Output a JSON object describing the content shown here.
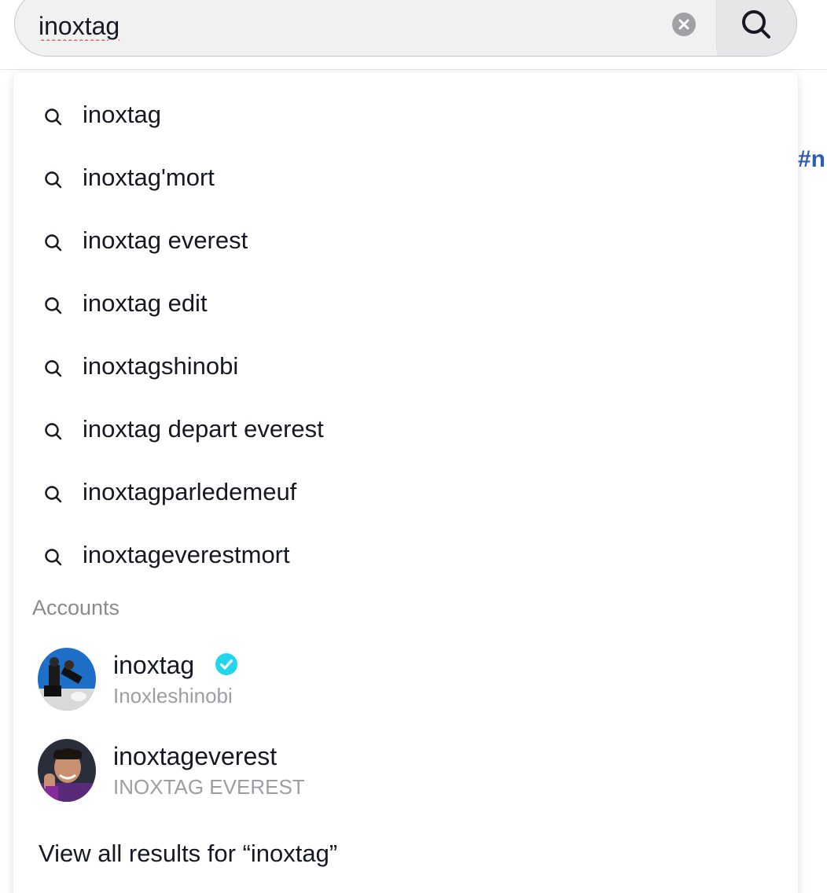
{
  "search": {
    "value": "inoxtag",
    "placeholder": "Search"
  },
  "background": {
    "hashtag_fragment": "#n"
  },
  "suggestions": [
    {
      "label": "inoxtag"
    },
    {
      "label": "inoxtag'mort"
    },
    {
      "label": "inoxtag everest"
    },
    {
      "label": "inoxtag edit"
    },
    {
      "label": "inoxtagshinobi"
    },
    {
      "label": "inoxtag depart everest"
    },
    {
      "label": "inoxtagparledemeuf"
    },
    {
      "label": "inoxtageverestmort"
    }
  ],
  "accounts_section": {
    "title": "Accounts",
    "items": [
      {
        "username": "inoxtag",
        "display_name": "Inoxleshinobi",
        "verified": true
      },
      {
        "username": "inoxtageverest",
        "display_name": "INOXTAG EVEREST",
        "verified": false
      }
    ]
  },
  "view_all": {
    "label": "View all results for “inoxtag”"
  },
  "colors": {
    "verified": "#20d5ec",
    "hashtag": "#2b5db6",
    "muted_text": "#8a8b91"
  },
  "icons": {
    "clear": "clear-icon",
    "search": "search-icon",
    "suggestion": "search-icon",
    "verified": "verified-badge-icon"
  }
}
